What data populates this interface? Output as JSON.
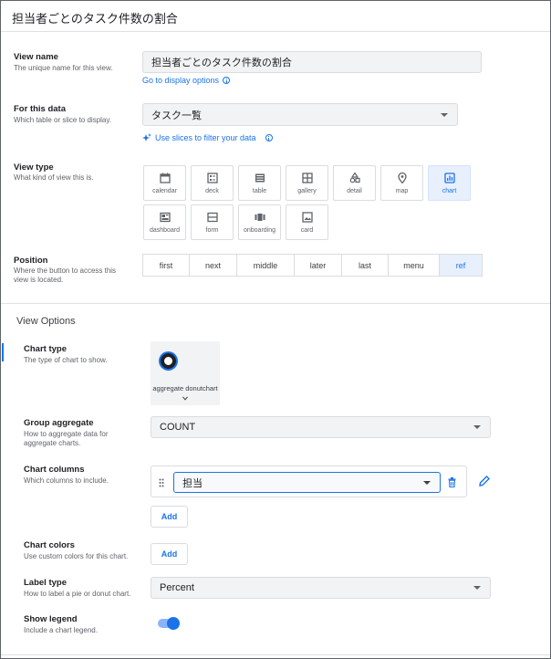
{
  "header": {
    "title": "担当者ごとのタスク件数の割合"
  },
  "view_name": {
    "label": "View name",
    "desc": "The unique name for this view.",
    "value": "担当者ごとのタスク件数の割合",
    "link": "Go to display options"
  },
  "for_data": {
    "label": "For this data",
    "desc": "Which table or slice to display.",
    "value": "タスク一覧",
    "link": "Use slices to filter your data"
  },
  "view_type": {
    "label": "View type",
    "desc": "What kind of view this is.",
    "types": [
      {
        "label": "calendar",
        "icon": "calendar-icon"
      },
      {
        "label": "deck",
        "icon": "deck-icon"
      },
      {
        "label": "table",
        "icon": "table-icon"
      },
      {
        "label": "gallery",
        "icon": "gallery-icon"
      },
      {
        "label": "detail",
        "icon": "detail-icon"
      },
      {
        "label": "map",
        "icon": "map-pin-icon"
      },
      {
        "label": "chart",
        "icon": "bar-chart-icon",
        "selected": true
      },
      {
        "label": "dashboard",
        "icon": "dashboard-icon"
      },
      {
        "label": "form",
        "icon": "form-icon"
      },
      {
        "label": "onboarding",
        "icon": "onboarding-icon"
      },
      {
        "label": "card",
        "icon": "card-icon"
      }
    ]
  },
  "position": {
    "label": "Position",
    "desc": "Where the button to access this view is located.",
    "options": [
      "first",
      "next",
      "middle",
      "later",
      "last",
      "menu",
      "ref"
    ],
    "selected": "ref"
  },
  "view_options": {
    "title": "View Options"
  },
  "chart_type": {
    "label": "Chart type",
    "desc": "The type of chart to show.",
    "value": "aggregate donutchart"
  },
  "group_aggregate": {
    "label": "Group aggregate",
    "desc": "How to aggregate data for aggregate charts.",
    "value": "COUNT"
  },
  "chart_columns": {
    "label": "Chart columns",
    "desc": "Which columns to include.",
    "value": "担当",
    "add": "Add"
  },
  "chart_colors": {
    "label": "Chart colors",
    "desc": "Use custom colors for this chart.",
    "add": "Add"
  },
  "label_type": {
    "label": "Label type",
    "desc": "How to label a pie or donut chart.",
    "value": "Percent"
  },
  "show_legend": {
    "label": "Show legend",
    "desc": "Include a chart legend.",
    "on": true
  },
  "colors": {
    "accent": "#1a73e8",
    "selected_bg": "#e8f0fe",
    "field_bg": "#f1f3f4"
  }
}
